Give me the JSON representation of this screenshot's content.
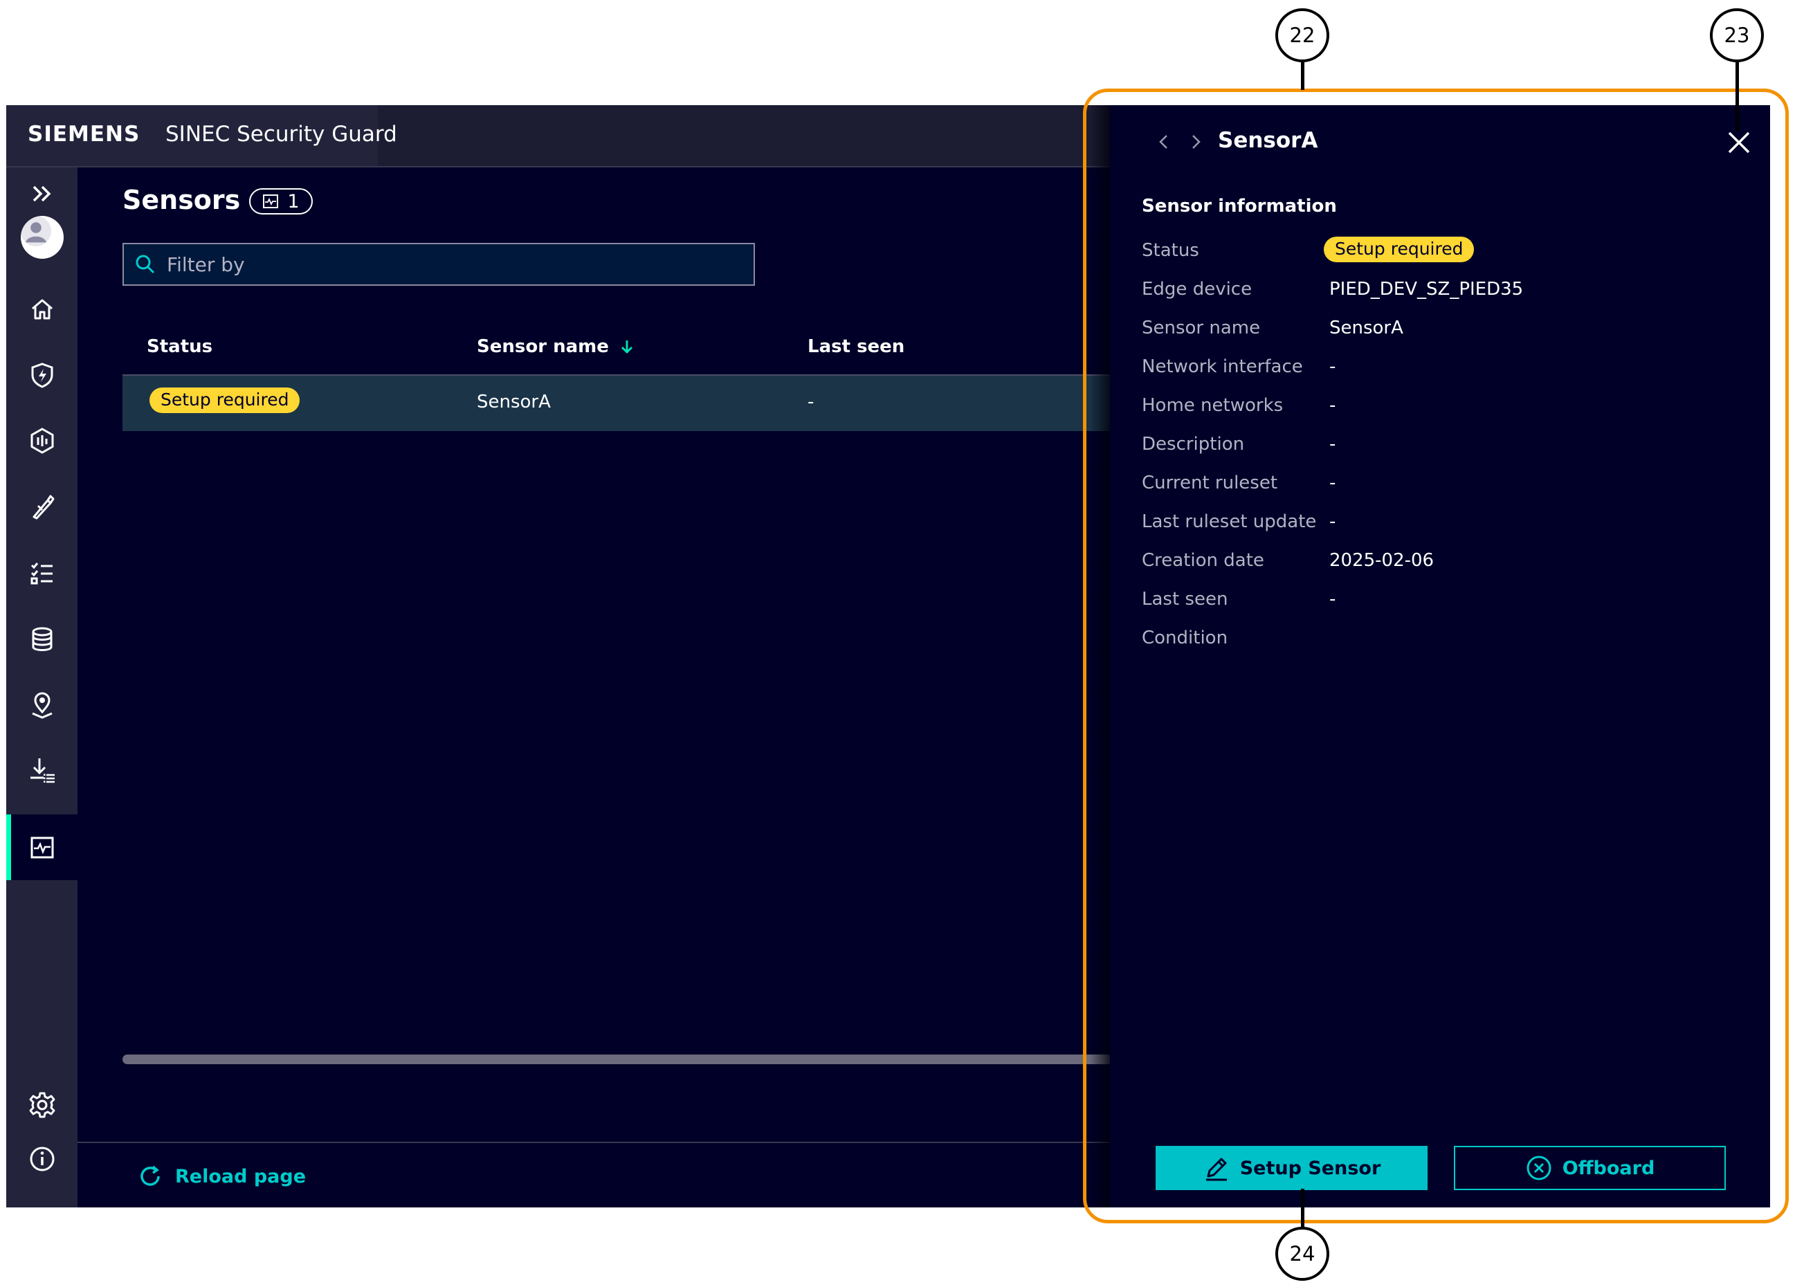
{
  "header": {
    "brand": "SIEMENS",
    "app_title": "SINEC Security Guard"
  },
  "sidebar": {
    "items": [
      {
        "name": "expand",
        "icon": "double-chevron-right-icon"
      },
      {
        "name": "user",
        "icon": "user-avatar-icon"
      },
      {
        "name": "home",
        "icon": "home-icon"
      },
      {
        "name": "security",
        "icon": "shield-bolt-icon"
      },
      {
        "name": "assets",
        "icon": "hexagon-chart-icon"
      },
      {
        "name": "tools",
        "icon": "pen-tools-icon"
      },
      {
        "name": "tasks",
        "icon": "checklist-icon"
      },
      {
        "name": "database",
        "icon": "database-icon"
      },
      {
        "name": "location",
        "icon": "location-pin-icon"
      },
      {
        "name": "import",
        "icon": "download-list-icon"
      },
      {
        "name": "sensors",
        "icon": "sensor-monitor-icon",
        "active": true
      },
      {
        "name": "settings",
        "icon": "gear-icon"
      },
      {
        "name": "info",
        "icon": "info-icon"
      }
    ]
  },
  "main": {
    "title": "Sensors",
    "count": "1",
    "filter_placeholder": "Filter by",
    "table": {
      "columns": [
        "Status",
        "Sensor name",
        "Last seen"
      ],
      "sort_column": "Sensor name",
      "rows": [
        {
          "status": "Setup required",
          "sensor_name": "SensorA",
          "last_seen": "-"
        }
      ]
    },
    "reload_label": "Reload page"
  },
  "panel": {
    "title": "SensorA",
    "section_title": "Sensor information",
    "fields": [
      {
        "label": "Status",
        "value": "Setup required"
      },
      {
        "label": "Edge device",
        "value": "PIED_DEV_SZ_PIED35"
      },
      {
        "label": "Sensor name",
        "value": "SensorA"
      },
      {
        "label": "Network interface",
        "value": "-"
      },
      {
        "label": "Home networks",
        "value": "-"
      },
      {
        "label": "Description",
        "value": "-"
      },
      {
        "label": "Current ruleset",
        "value": "-"
      },
      {
        "label": "Last ruleset update",
        "value": "-"
      },
      {
        "label": "Creation date",
        "value": "2025-02-06"
      },
      {
        "label": "Last seen",
        "value": "-"
      },
      {
        "label": "Condition",
        "value": ""
      }
    ],
    "setup_button": "Setup Sensor",
    "offboard_button": "Offboard"
  },
  "callouts": [
    "22",
    "23",
    "24"
  ],
  "colors": {
    "background": "#000028",
    "accent": "#00cccc",
    "status_warning": "#ffd732",
    "active_indicator": "#00ffb9",
    "annotation_frame": "#f39200"
  }
}
